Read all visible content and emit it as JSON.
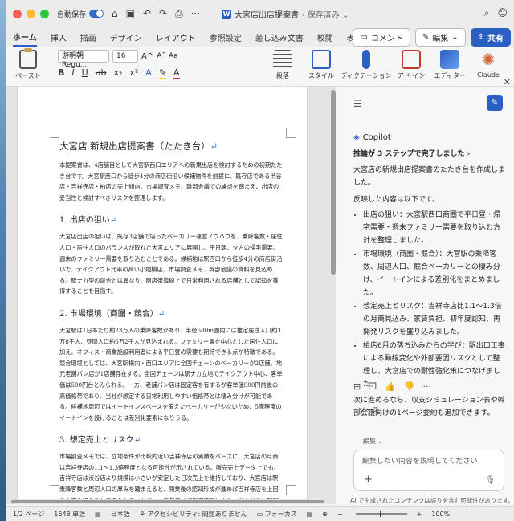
{
  "titlebar": {
    "autosave_label": "自動保存",
    "doc_title": "大宮店出店提案書",
    "doc_status": "- 保存済み ⌄"
  },
  "tabs": [
    {
      "label": "ホーム",
      "active": true
    },
    {
      "label": "挿入"
    },
    {
      "label": "描画"
    },
    {
      "label": "デザイン"
    },
    {
      "label": "レイアウト"
    },
    {
      "label": "参照設定"
    },
    {
      "label": "差し込み文書"
    },
    {
      "label": "校閲"
    },
    {
      "label": "表示"
    }
  ],
  "tab_actions": {
    "comment": "コメント",
    "edit": "編集",
    "share": "共有"
  },
  "ribbon": {
    "paste": "ペースト",
    "font_name": "游明朝 Regu...",
    "font_size": "16",
    "paragraph": "段落",
    "style": "スタイル",
    "dictation": "ディクテーション",
    "addins": "アド イン",
    "editor": "エディター",
    "claude": "Claude"
  },
  "document": {
    "title": "大宮店 新規出店提案書（たたき台）",
    "intro": "本提案書は、4店舗目として大宮駅西口エリアへの新規出店を検討するための初期たたき台です。大宮駅西口から徒歩4分の商店街沿い候補物件を前提に、既存店である渋谷店・吉祥寺店・柏店の売上傾向、市場調査メモ、幹部会議での論点を踏まえ、出店の妥当性と検討すべきリスクを整理します。",
    "h1": "1. 出店の狙い",
    "p1": "大宮店出店の狙いは、既存3店舗で培ったベーカリー運営ノウハウを、乗降客数・居住人口・居住人口のバランスが取れた大宮エリアに展開し、平日朝、夕方の帰宅需要、週末のファミリー需要を取り込むことである。候補地は駅西口から徒歩4分の商店街沿いで、テイクアウト比率の高い小規模店、市場調査メモ、幹部会議の資料を見込める。駅ナカ型の競合とは異なり、商店街導線上で日常利用される店舗として認知を獲得することを目指す。",
    "h2": "2. 市場環境（商圏・競合）",
    "p2": "大宮駅は1日あたり約23万人の乗降客数があり、半径500m圏内には推定居住人口約3万8千人、昼間人口約6万2千人が見込まれる。ファミリー層を中心とした居住人口に加え、オフィス・商業施設利用者による平日昼の需要も期待できる点が特徴である。競合環境としては、大宮駅構内・西口エリアに全国チェーンのベーカリーが2店舗、地元老舗パン店が1店舗存在する。全国チェーンは駅ナカ立地でテイクアウト中心、客単価は500円台とみられる。一方、老舗パン店は固定客を有するが客単価900円前後の高価格帯であり、当社が想定する日常利用しやすい価格帯とは棲み分けが可能である。候補地周辺ではイートインスペースを備えたベーカリーが少ないため、5席程度のイートインを設けることは差別化要素になりうる。",
    "h3": "3. 想定売上とリスク",
    "p3": "市場調査メモでは、立地条件が比較的近い吉祥寺店の実績をベースに、大宮店の月商は吉祥寺店の1.1〜1.3倍程度となる可能性が示されている。販売売上データ上でも、吉祥寺店は渋谷店より規模は小さいが安定した日次売上を維持しており、大宮店は駅乗降客数と周辺人口の厚みを踏まえると、開業後の認知形成が進めば吉祥寺店を上回る水準を狙えると考えられる。ただし、初年度は認知度不足により立ち上がりに時間を要する可能性がある。加えて、候補物件の想定賃料は月額58万円であり、吉祥寺店の家賃の約1.4倍とされている。固定費"
  },
  "copilot": {
    "name": "Copilot",
    "steps": "推論が 3 ステップで完了しました ›",
    "msg1": "大宮店の新規出店提案書のたたき台を作成しました。",
    "msg2": "反映した内容は以下です。",
    "bullets": [
      "出店の狙い：大宮駅西口商圏で平日昼・帰宅需要・週末ファミリー需要を取り込む方針を整理しました。",
      "市場環境（商圏・競合）：大宮駅の乗降客数、周辺人口、競合ベーカリーとの棲み分け、イートインによる差別化をまとめました。",
      "想定売上とリスク：吉祥寺店比1.1〜1.3倍の月商見込み、家賃負担、初年度認知、再開発リスクを盛り込みました。",
      "柏店6月の落ち込みからの学び：駅出口工事による動線変化や外部要因リスクとして整理し、大宮店での耐性強化策につなげました。"
    ],
    "msg3": "次に進めるなら、収支シミュレーション表や幹部会議向けの1ページ要約も追加できます。",
    "source": "ソース",
    "edit_label": "編集 ⌄",
    "input_placeholder": "編集したい内容を説明してください",
    "disclaimer": "AI で生成されたコンテンツは誤りを含む可能性があります。"
  },
  "status": {
    "page": "1/2 ページ",
    "words": "1648 単語",
    "lang": "日本語",
    "accessibility": "アクセシビリティ: 問題ありません",
    "focus": "フォーカス",
    "zoom": "100%"
  },
  "colors": {
    "accent": "#2b5fc1",
    "paragraph_mark": "#4a78c8"
  }
}
